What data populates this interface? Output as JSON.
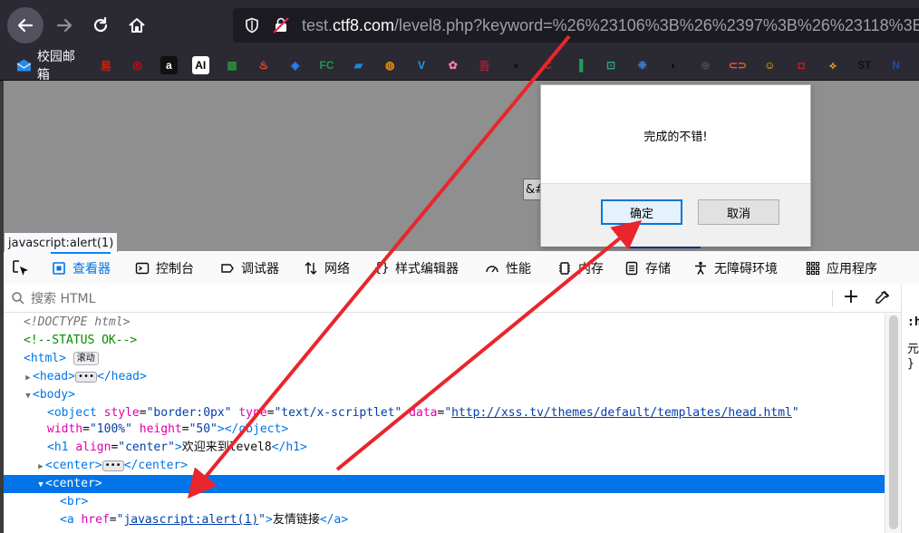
{
  "browser": {
    "url_prefix": "test.",
    "url_host": "ctf8.com",
    "url_rest": "/level8.php?keyword=%26%23106%3B%26%2397%3B%26%23118%3B"
  },
  "bookmarks": {
    "first_label": "校园邮箱",
    "icons": [
      {
        "glyph": "易",
        "color": "#d81e06"
      },
      {
        "glyph": "◎",
        "color": "#e60012"
      },
      {
        "glyph": "a",
        "color": "#ffffff"
      },
      {
        "glyph": "AI",
        "color": "#000000"
      },
      {
        "glyph": "▦",
        "color": "#2e8b3a"
      },
      {
        "glyph": "♨",
        "color": "#ff4b2b"
      },
      {
        "glyph": "◈",
        "color": "#2d7cf6"
      },
      {
        "glyph": "FC",
        "color": "#1d9a4b"
      },
      {
        "glyph": "▰",
        "color": "#1b8bd6"
      },
      {
        "glyph": "◍",
        "color": "#f08c00"
      },
      {
        "glyph": "V",
        "color": "#1aa1e0"
      },
      {
        "glyph": "✿",
        "color": "#ff7ab0"
      },
      {
        "glyph": "吾",
        "color": "#c8102e"
      },
      {
        "glyph": "●",
        "color": "#181717"
      },
      {
        "glyph": "C",
        "color": "#d01f1f"
      },
      {
        "glyph": "▐",
        "color": "#1e9e57"
      },
      {
        "glyph": "⊡",
        "color": "#2aa37a"
      },
      {
        "glyph": "❉",
        "color": "#3a7bd5"
      },
      {
        "glyph": "◐",
        "color": "#0c0c0d"
      },
      {
        "glyph": "⊕",
        "color": "#4a4a4a"
      },
      {
        "glyph": "⊂⊃",
        "color": "#f05a28"
      },
      {
        "glyph": "☺",
        "color": "#f7c600"
      },
      {
        "glyph": "◘",
        "color": "#e0192b"
      },
      {
        "glyph": "⟡",
        "color": "#f5a623"
      },
      {
        "glyph": "ST",
        "color": "#111111"
      },
      {
        "glyph": "N",
        "color": "#1f4e9c"
      }
    ]
  },
  "page": {
    "input_value": "&#"
  },
  "dialog": {
    "message": "完成的不错!",
    "ok_label": "确定",
    "cancel_label": "取消"
  },
  "tooltip": "javascript:alert(1)",
  "devtools": {
    "tabs": [
      "查看器",
      "控制台",
      "调试器",
      "网络",
      "样式编辑器",
      "性能",
      "内存",
      "存储",
      "无障碍环境",
      "应用程序"
    ],
    "search_placeholder": "搜索 HTML",
    "side": [
      ":h",
      "元",
      "}"
    ],
    "tree": {
      "doctype": "<!DOCTYPE html>",
      "comment": "<!--STATUS OK-->",
      "html_open": "<html>",
      "html_badge": "滚动",
      "head_open": "<head>",
      "head_close": "</head>",
      "body_open": "<body>",
      "object_open": "<object",
      "attr_style": "style",
      "val_style": "\"border:0px\"",
      "attr_type": "type",
      "val_type": "\"text/x-scriptlet\"",
      "attr_data": "data",
      "val_data_q1": "\"",
      "val_data_link": "http://xss.tv/themes/default/templates/head.html",
      "val_data_q2": "\"",
      "attr_width": "width",
      "val_width": "\"100%\"",
      "attr_height": "height",
      "val_height": "\"50\"",
      "object_close": "></object>",
      "h1_open": "<h1",
      "attr_align": "align",
      "val_align": "\"center\"",
      "h1_gt": ">",
      "h1_text": "欢迎来到level8",
      "h1_close": "</h1>",
      "center_open": "<center>",
      "center_close": "</center>",
      "br": "<br>",
      "a_open": "<a",
      "attr_href": "href",
      "val_href_q1": "\"",
      "val_href_link": "javascript:alert(1)",
      "val_href_q2": "\"",
      "a_gt": ">",
      "a_text": "友情链接",
      "a_close": "</a>"
    }
  }
}
